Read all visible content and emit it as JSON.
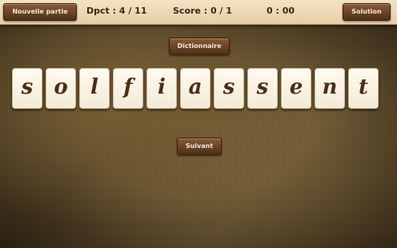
{
  "header": {
    "new_game_label": "Nouvelle partie",
    "dpct": "Dpct : 4 / 11",
    "score": "Score : 0 / 1",
    "timer": "0 : 00",
    "solution_label": "Solution"
  },
  "main": {
    "dictionary_label": "Dictionnaire",
    "next_label": "Suivant",
    "letters": [
      "s",
      "o",
      "l",
      "f",
      "i",
      "a",
      "s",
      "s",
      "e",
      "n",
      "t"
    ]
  },
  "colors": {
    "tile_text": "#4a2e18",
    "button_bg": "#6b4226",
    "topbar_bg": "#ecd8b4"
  }
}
